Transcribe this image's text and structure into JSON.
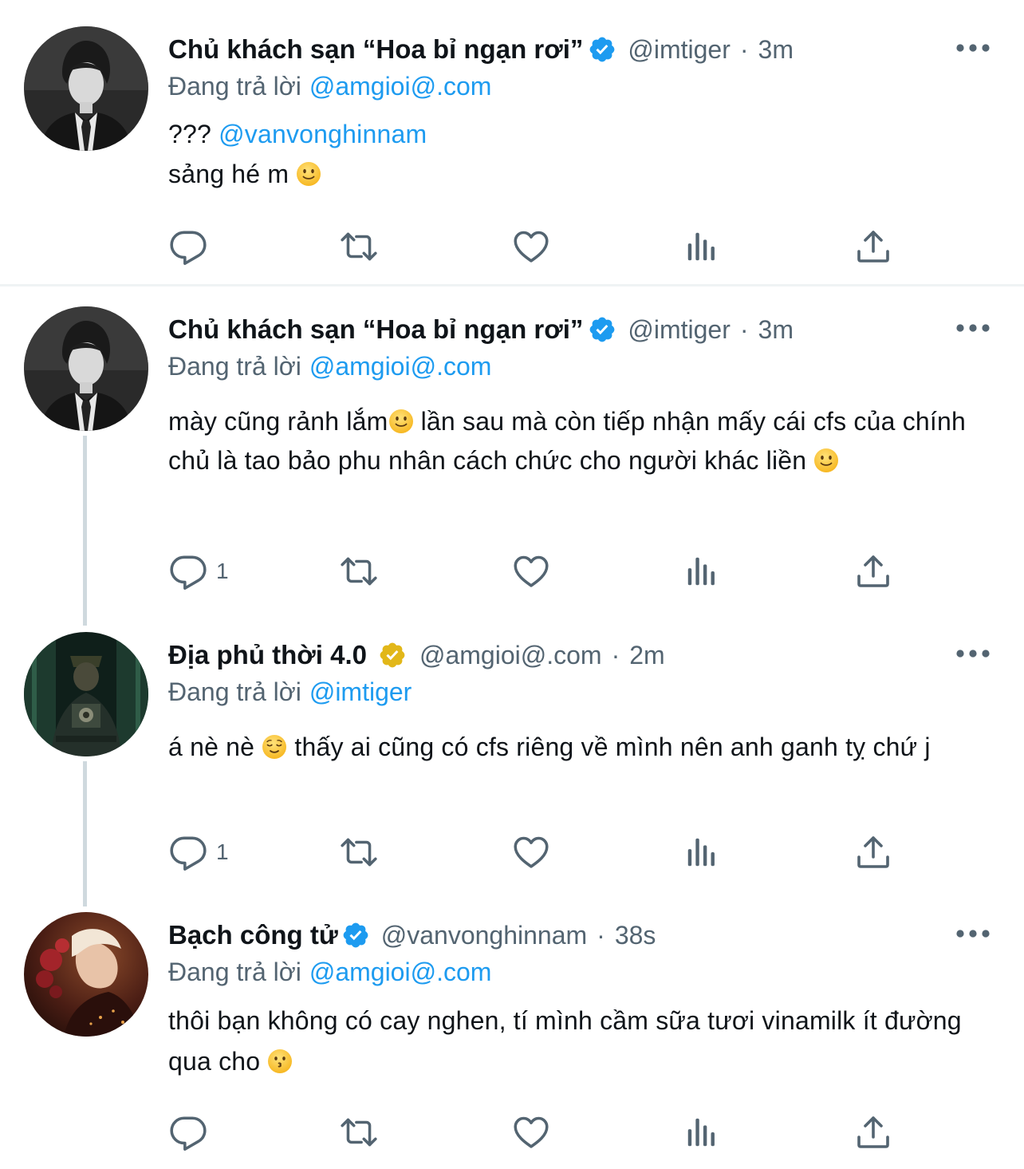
{
  "colors": {
    "link": "#1d9bf0",
    "secondary_text": "#536471",
    "primary_text": "#0f1419",
    "verified_blue": "#1d9bf0",
    "verified_gold": "#e2b719",
    "divider": "#eff3f4",
    "thread_line": "#cfd9de"
  },
  "icons": {
    "reply": "reply-icon",
    "retweet": "retweet-icon",
    "like": "heart-icon",
    "views": "views-icon",
    "share": "share-icon",
    "more": "more-icon",
    "verified": "verified-badge-icon"
  },
  "tweets": [
    {
      "display_name": "Chủ khách sạn “Hoa bỉ ngạn rơi”",
      "verified": "blue",
      "handle": "@imtiger",
      "separator": "·",
      "time": "3m",
      "reply_prefix": "Đang trả lời",
      "reply_to": "@amgioi@.com",
      "lines": [
        {
          "text": "??? ",
          "mention": "@vanvonghinnam"
        },
        {
          "text": "sảng hé m ",
          "emoji": "slightly-smiling-face"
        }
      ],
      "reply_count": ""
    },
    {
      "display_name": "Chủ khách sạn “Hoa bỉ ngạn rơi”",
      "verified": "blue",
      "handle": "@imtiger",
      "separator": "·",
      "time": "3m",
      "reply_prefix": "Đang trả lời",
      "reply_to": "@amgioi@.com",
      "text_a": "mày cũng rảnh lắm",
      "text_b": " lần sau mà còn tiếp nhận mấy cái cfs của chính chủ là tao bảo phu nhân cách chức cho người khác liền ",
      "emojis": [
        "slightly-smiling-face",
        "slightly-smiling-face"
      ],
      "reply_count": "1"
    },
    {
      "display_name": "Địa phủ thời 4.0",
      "verified": "gold",
      "handle": "@amgioi@.com",
      "separator": "·",
      "time": "2m",
      "reply_prefix": "Đang trả lời",
      "reply_to": "@imtiger",
      "text_a": "á nè nè ",
      "text_b": " thấy ai cũng có cfs riêng về mình nên anh ganh tỵ chứ j",
      "emojis": [
        "relieved-face"
      ],
      "reply_count": "1"
    },
    {
      "display_name": "Bạch công tử",
      "verified": "blue",
      "handle": "@vanvonghinnam",
      "separator": "·",
      "time": "38s",
      "reply_prefix": "Đang trả lời",
      "reply_to": "@amgioi@.com",
      "text_a": "thôi bạn không có cay nghen, tí mình cầm sữa tươi vinamilk ít đường qua cho ",
      "emojis": [
        "kissing-face"
      ],
      "reply_count": ""
    }
  ]
}
